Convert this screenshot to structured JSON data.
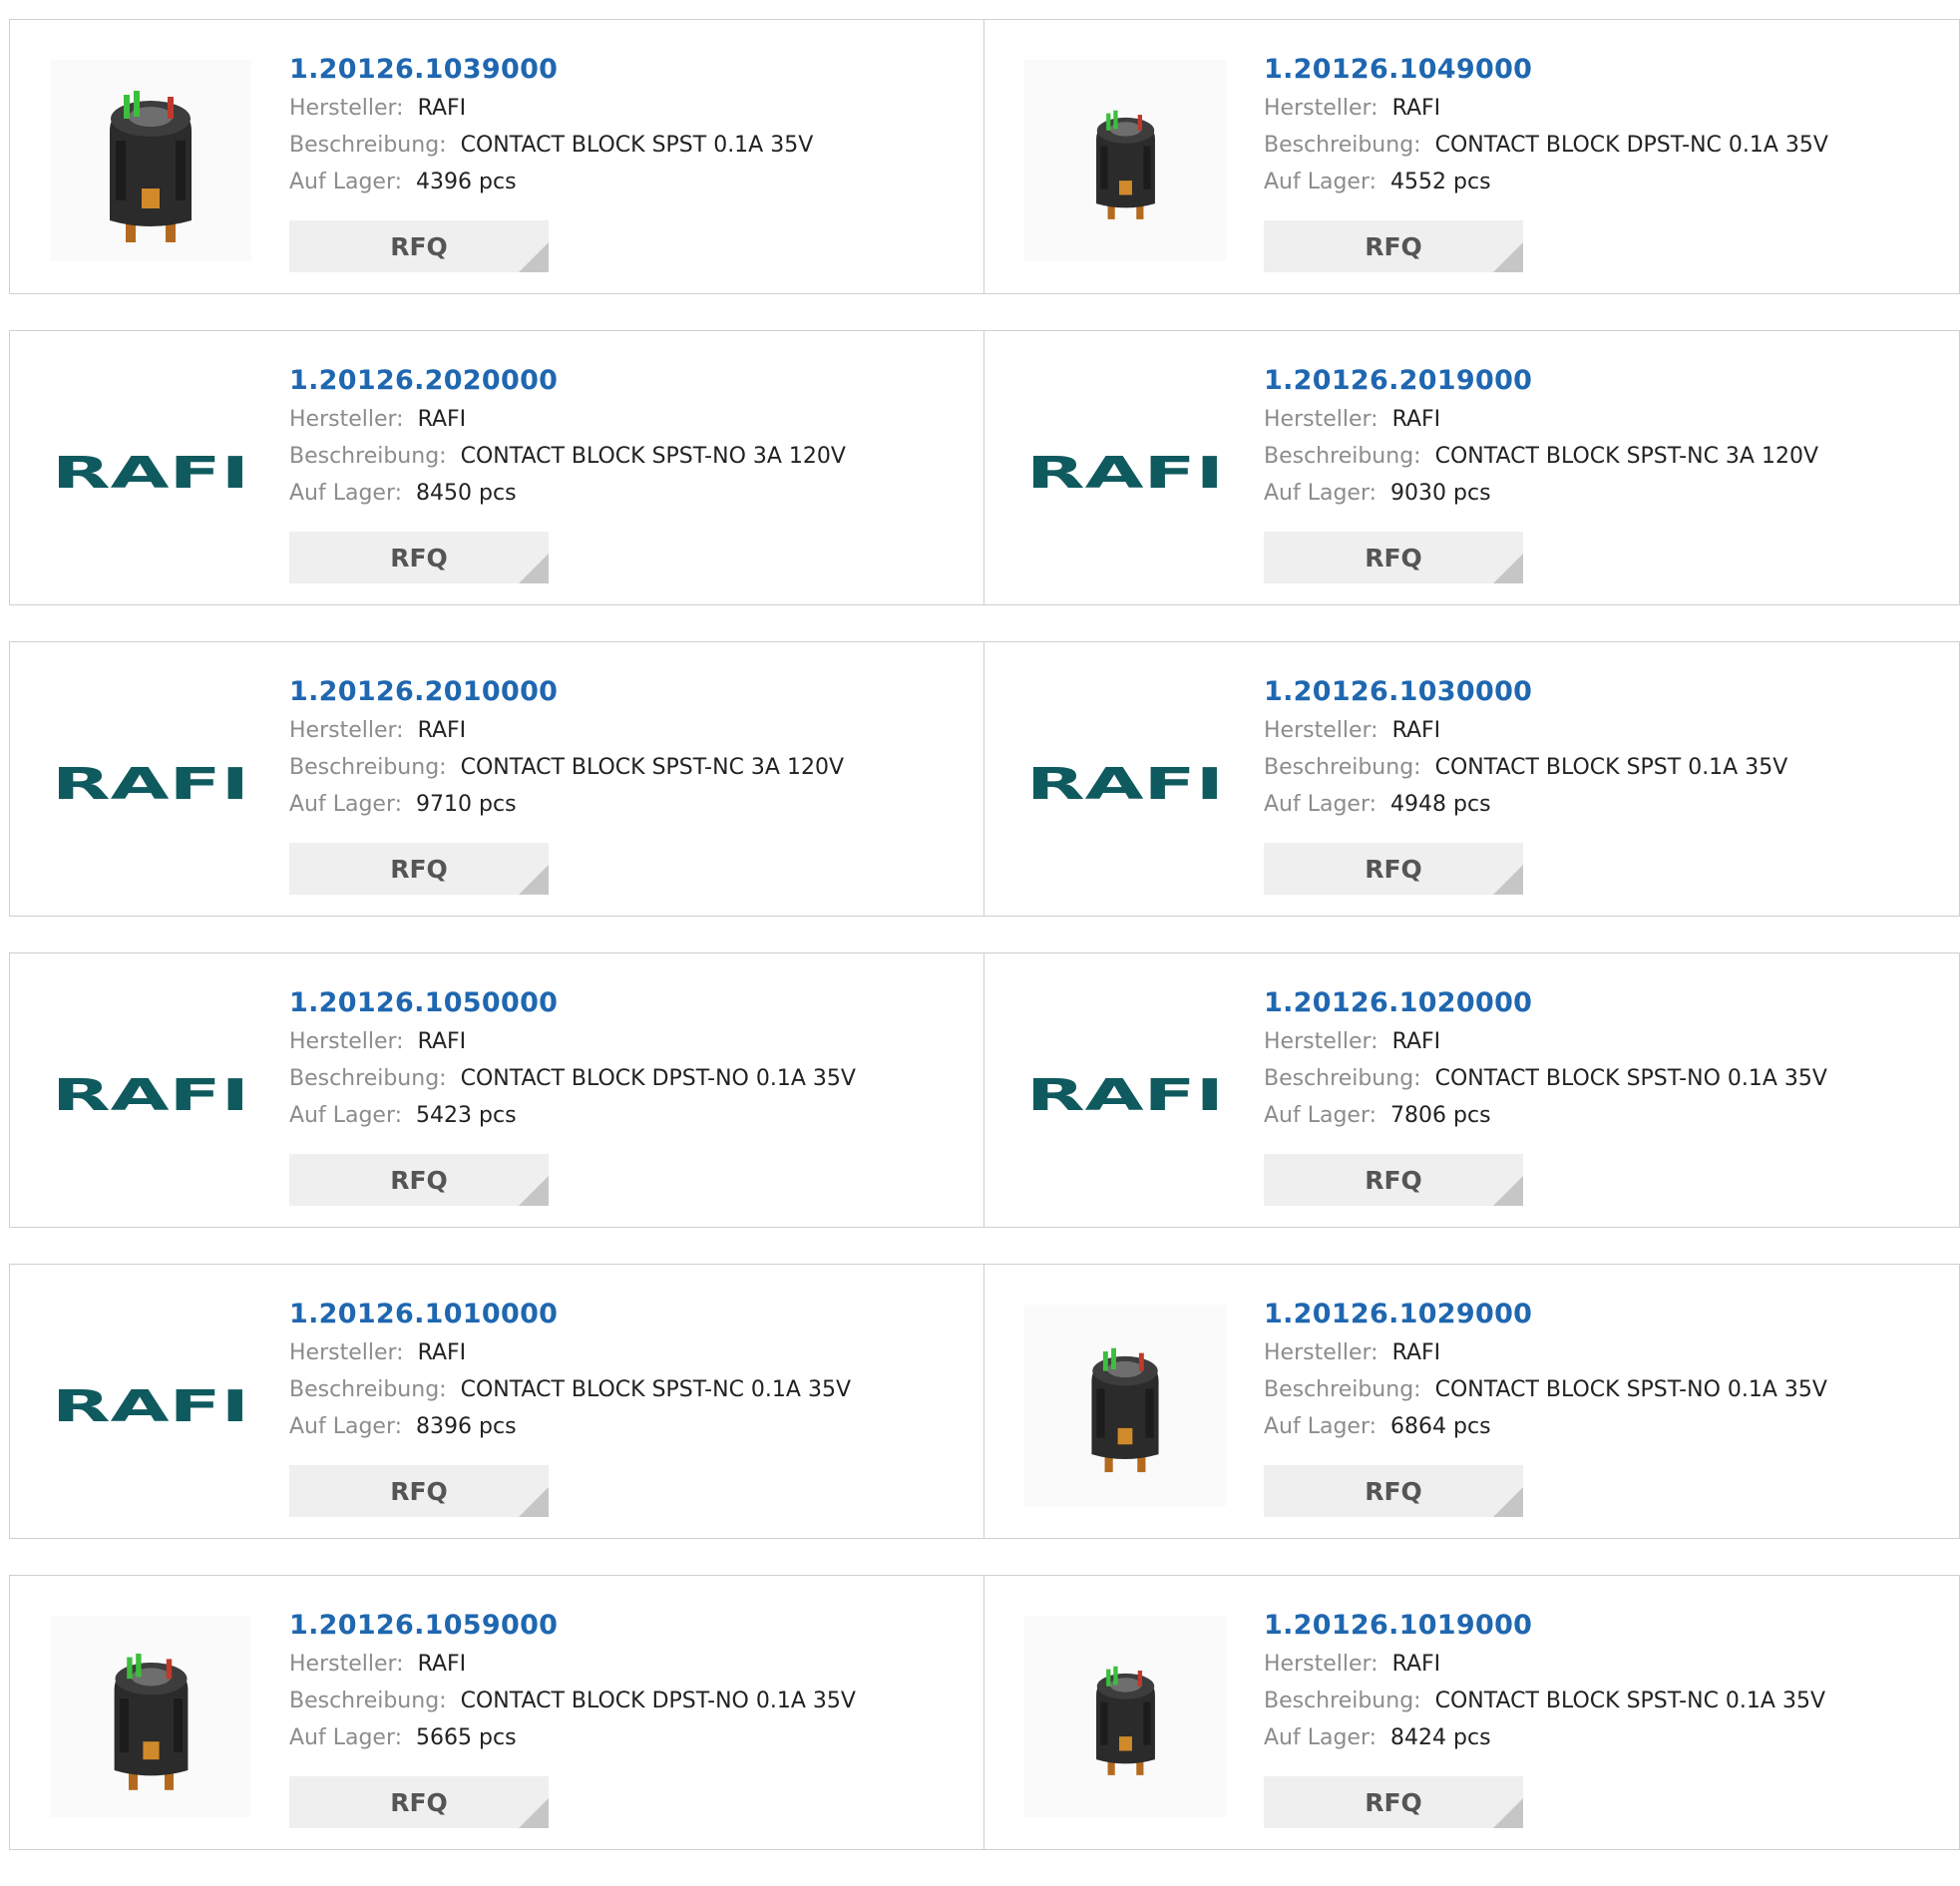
{
  "labels": {
    "manufacturer": "Hersteller:",
    "description": "Beschreibung:",
    "stock": "Auf Lager:",
    "rfq": "RFQ"
  },
  "brand_logo_text": "RAFI",
  "colors": {
    "part_link": "#1f67b0",
    "logo": "#0f5a5e",
    "rfq_bg": "#efefef"
  },
  "products": [
    {
      "part": "1.20126.1039000",
      "manufacturer": "RAFI",
      "description": "CONTACT BLOCK SPST 0.1A 35V",
      "stock": "4396 pcs",
      "image": "contact-block-photo"
    },
    {
      "part": "1.20126.1049000",
      "manufacturer": "RAFI",
      "description": "CONTACT BLOCK DPST-NC 0.1A 35V",
      "stock": "4552 pcs",
      "image": "contact-block-photo"
    },
    {
      "part": "1.20126.2020000",
      "manufacturer": "RAFI",
      "description": "CONTACT BLOCK SPST-NO 3A 120V",
      "stock": "8450 pcs",
      "image": "rafi-logo"
    },
    {
      "part": "1.20126.2019000",
      "manufacturer": "RAFI",
      "description": "CONTACT BLOCK SPST-NC 3A 120V",
      "stock": "9030 pcs",
      "image": "rafi-logo"
    },
    {
      "part": "1.20126.2010000",
      "manufacturer": "RAFI",
      "description": "CONTACT BLOCK SPST-NC 3A 120V",
      "stock": "9710 pcs",
      "image": "rafi-logo"
    },
    {
      "part": "1.20126.1030000",
      "manufacturer": "RAFI",
      "description": "CONTACT BLOCK SPST 0.1A 35V",
      "stock": "4948 pcs",
      "image": "rafi-logo"
    },
    {
      "part": "1.20126.1050000",
      "manufacturer": "RAFI",
      "description": "CONTACT BLOCK DPST-NO 0.1A 35V",
      "stock": "5423 pcs",
      "image": "rafi-logo"
    },
    {
      "part": "1.20126.1020000",
      "manufacturer": "RAFI",
      "description": "CONTACT BLOCK SPST-NO 0.1A 35V",
      "stock": "7806 pcs",
      "image": "rafi-logo"
    },
    {
      "part": "1.20126.1010000",
      "manufacturer": "RAFI",
      "description": "CONTACT BLOCK SPST-NC 0.1A 35V",
      "stock": "8396 pcs",
      "image": "rafi-logo"
    },
    {
      "part": "1.20126.1029000",
      "manufacturer": "RAFI",
      "description": "CONTACT BLOCK SPST-NO 0.1A 35V",
      "stock": "6864 pcs",
      "image": "contact-block-photo"
    },
    {
      "part": "1.20126.1059000",
      "manufacturer": "RAFI",
      "description": "CONTACT BLOCK DPST-NO 0.1A 35V",
      "stock": "5665 pcs",
      "image": "contact-block-photo"
    },
    {
      "part": "1.20126.1019000",
      "manufacturer": "RAFI",
      "description": "CONTACT BLOCK SPST-NC 0.1A 35V",
      "stock": "8424 pcs",
      "image": "contact-block-photo"
    }
  ]
}
